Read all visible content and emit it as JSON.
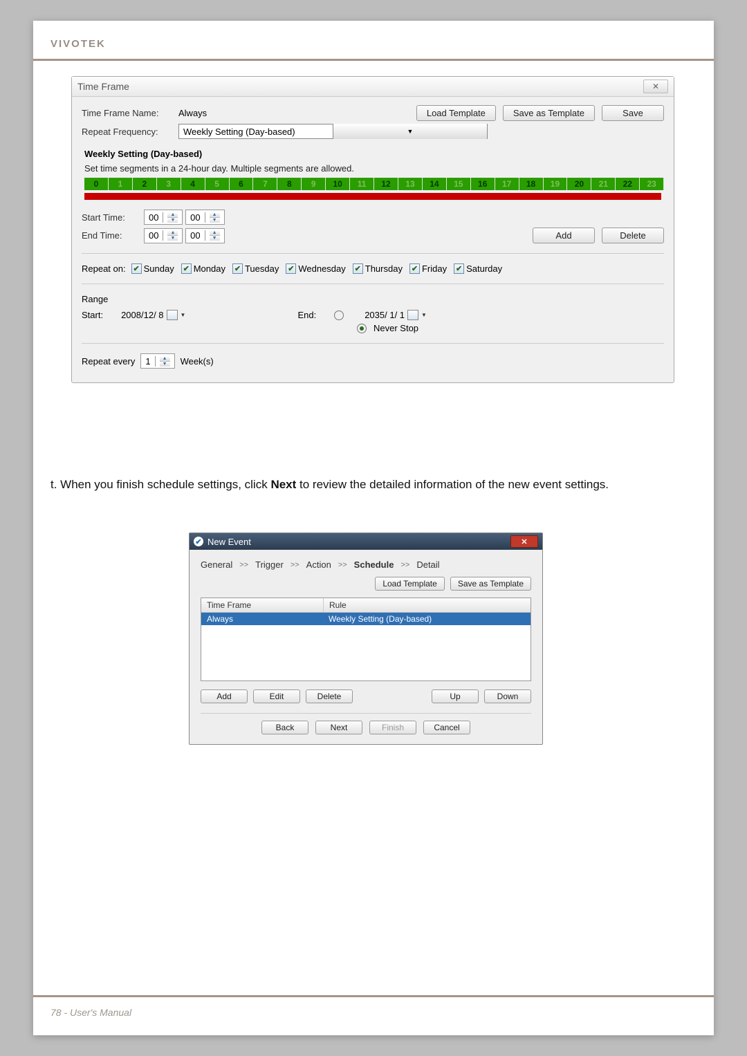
{
  "brand": "VIVOTEK",
  "footer": "78 - User's Manual",
  "dlg1": {
    "title": "Time Frame",
    "close": "✕",
    "name_label": "Time Frame Name:",
    "name_value": "Always",
    "freq_label": "Repeat Frequency:",
    "freq_value": "Weekly Setting (Day-based)",
    "load_template": "Load Template",
    "save_template": "Save as Template",
    "save": "Save",
    "section": "Weekly Setting (Day-based)",
    "hint": "Set time segments in a 24-hour day. Multiple segments are allowed.",
    "hours": [
      "0",
      "1",
      "2",
      "3",
      "4",
      "5",
      "6",
      "7",
      "8",
      "9",
      "10",
      "11",
      "12",
      "13",
      "14",
      "15",
      "16",
      "17",
      "18",
      "19",
      "20",
      "21",
      "22",
      "23"
    ],
    "start_label": "Start Time:",
    "start_h": "00",
    "start_m": "00",
    "end_label": "End Time:",
    "end_h": "00",
    "end_m": "00",
    "add": "Add",
    "delete": "Delete",
    "repeat_on": "Repeat on:",
    "days": [
      "Sunday",
      "Monday",
      "Tuesday",
      "Wednesday",
      "Thursday",
      "Friday",
      "Saturday"
    ],
    "range": "Range",
    "range_start_lbl": "Start:",
    "range_start_val": "2008/12/ 8",
    "range_end_lbl": "End:",
    "range_end_val": "2035/ 1/ 1",
    "never_stop": "Never Stop",
    "repeat_every_lbl": "Repeat every",
    "repeat_every_val": "1",
    "repeat_every_unit": "Week(s)"
  },
  "para_pre": "t. When you finish schedule settings, click ",
  "para_bold": "Next",
  "para_post": " to review the detailed information of the new event settings.",
  "dlg2": {
    "title": "New Event",
    "crumb": [
      "General",
      "Trigger",
      "Action",
      "Schedule",
      "Detail"
    ],
    "crumb_active": 3,
    "sep": ">>",
    "load_template": "Load Template",
    "save_template": "Save as Template",
    "col_tf": "Time Frame",
    "col_rule": "Rule",
    "row_tf": "Always",
    "row_rule": "Weekly Setting (Day-based)",
    "add": "Add",
    "edit": "Edit",
    "del": "Delete",
    "up": "Up",
    "down": "Down",
    "back": "Back",
    "next": "Next",
    "finish": "Finish",
    "cancel": "Cancel"
  }
}
